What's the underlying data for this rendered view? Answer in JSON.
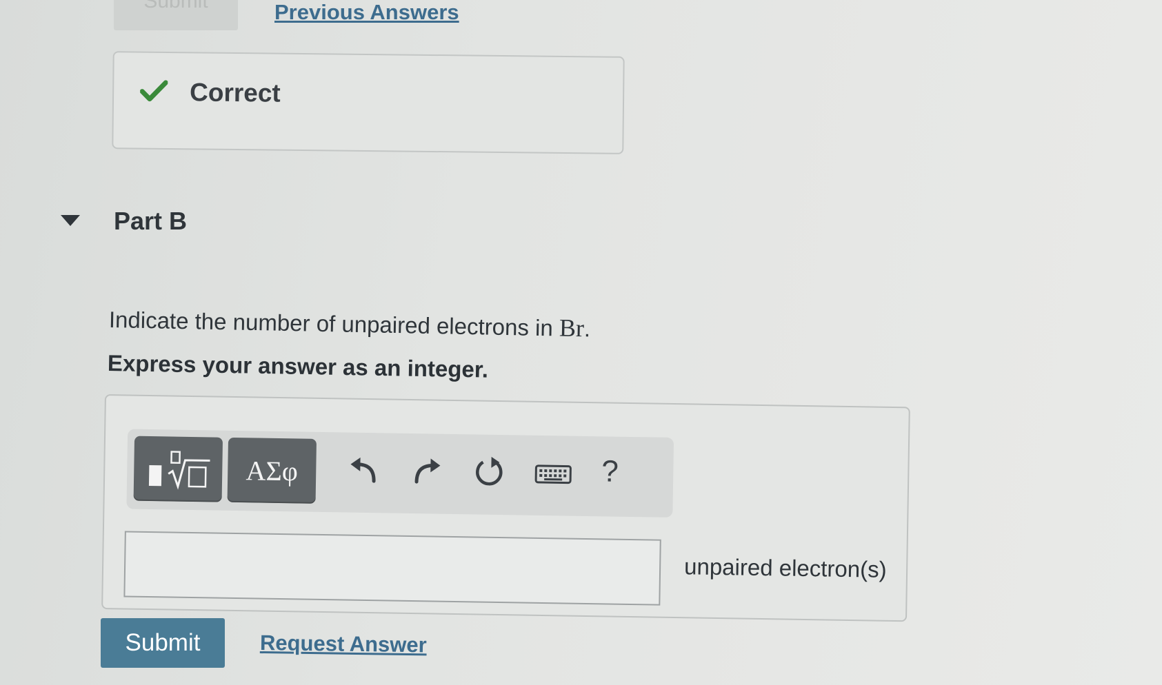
{
  "previous": {
    "submit_label": "Submit",
    "previous_answers_label": "Previous Answers"
  },
  "feedback": {
    "status_label": "Correct",
    "icon": "check-icon",
    "color": "#3a8a3a"
  },
  "part_b": {
    "title": "Part B",
    "question_text": "Indicate the number of unpaired electrons in ",
    "element": "Br",
    "question_end": ".",
    "instruction": "Express your answer as an integer.",
    "toolbar": {
      "templates_icon": "templates-icon",
      "greek_label": "ΑΣφ",
      "undo_icon": "undo-icon",
      "redo_icon": "redo-icon",
      "reset_icon": "reset-icon",
      "keyboard_icon": "keyboard-icon",
      "help_label": "?"
    },
    "answer_value": "",
    "units": "unpaired electron(s)",
    "submit_label": "Submit",
    "request_answer_label": "Request Answer"
  },
  "colors": {
    "accent": "#4a7c96",
    "link": "#3d6c8e"
  }
}
